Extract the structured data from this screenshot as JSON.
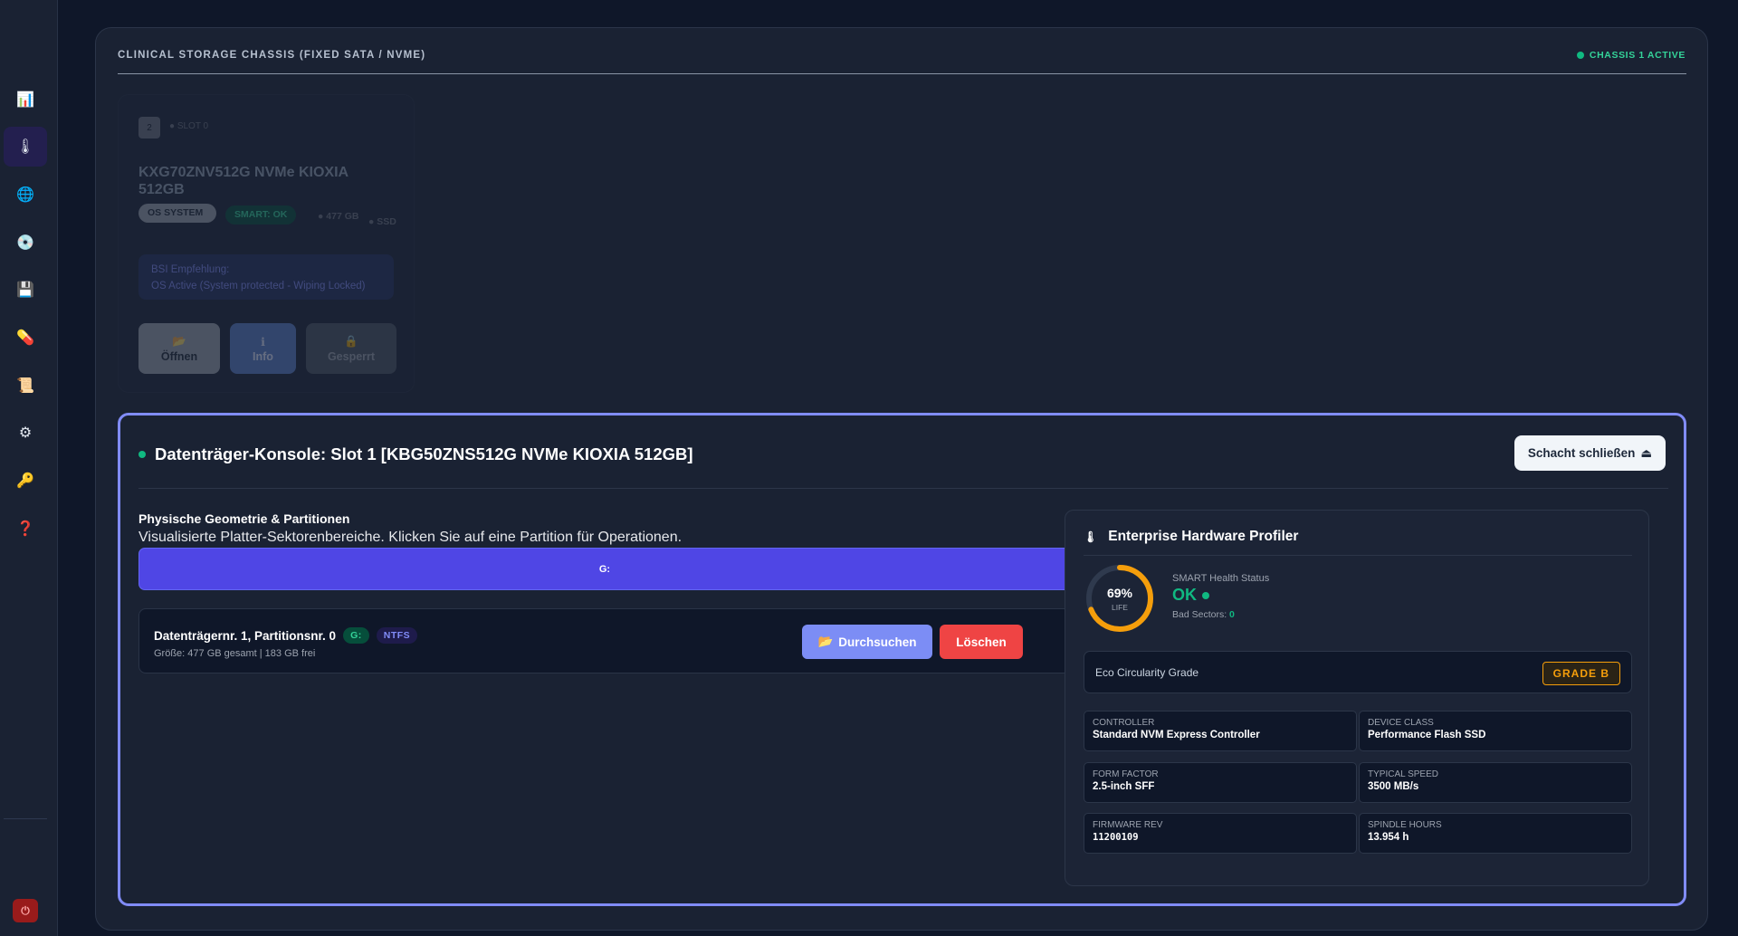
{
  "sidebar": {
    "items": [
      {
        "name": "chart-icon",
        "glyph": "📊"
      },
      {
        "name": "thermometer-icon",
        "glyph": "🌡"
      },
      {
        "name": "globe-icon",
        "glyph": "🌐"
      },
      {
        "name": "disc-icon",
        "glyph": "💿"
      },
      {
        "name": "floppy-icon",
        "glyph": "💾"
      },
      {
        "name": "pill-icon",
        "glyph": "💊"
      },
      {
        "name": "scroll-icon",
        "glyph": "📜"
      },
      {
        "name": "gear-icon",
        "glyph": "⚙"
      },
      {
        "name": "key-icon",
        "glyph": "🔑"
      },
      {
        "name": "help-icon",
        "glyph": "❓"
      }
    ],
    "power_glyph": "⏻"
  },
  "chassis": {
    "title": "CLINICAL STORAGE CHASSIS (FIXED SATA / NVME)",
    "status": "CHASSIS 1 ACTIVE"
  },
  "drive_card": {
    "slot_number": "2",
    "slot_label": "SLOT 0",
    "model": "KXG70ZNV512G NVMe KIOXIA 512GB",
    "os_chip": "OS SYSTEM",
    "smart_chip": "SMART: OK",
    "size": "477 GB",
    "type": "SSD",
    "rec_label": "BSI Empfehlung:",
    "rec_text": "OS Active (System protected - Wiping Locked)",
    "btn_open": "Öffnen",
    "btn_info": "Info",
    "btn_locked": "Gesperrt",
    "btn_open_glyph": "📂",
    "btn_info_glyph": "ℹ",
    "btn_locked_glyph": "🔒"
  },
  "console": {
    "title": "Datenträger-Konsole: Slot 1 [KBG50ZNS512G NVMe KIOXIA 512GB]",
    "close_button": "Schacht schließen",
    "close_glyph": "⏏",
    "geometry_title": "Physische Geometrie & Partitionen",
    "geometry_subtitle": "Visualisierte Platter-Sektorenbereiche. Klicken Sie auf eine Partition für Operationen.",
    "partition_bar_label": "G:",
    "partition": {
      "name": "Datenträgernr. 1, Partitionsnr. 0",
      "drive_letter": "G:",
      "filesystem": "NTFS",
      "meta": "Größe: 477 GB gesamt | 183 GB frei",
      "browse_button": "Durchsuchen",
      "browse_glyph": "📂",
      "delete_button": "Löschen"
    }
  },
  "profiler": {
    "title": "Enterprise Hardware Profiler",
    "title_glyph": "🌡",
    "life_percent": 69,
    "life_text": "69%",
    "life_label": "LIFE",
    "health_label": "SMART Health Status",
    "health_value": "OK",
    "bad_sectors_label": "Bad Sectors:",
    "bad_sectors_value": "0",
    "eco_label": "Eco Circularity Grade",
    "eco_grade": "GRADE B",
    "specs": [
      {
        "key": "CONTROLLER",
        "value": "Standard NVM Express Controller"
      },
      {
        "key": "DEVICE CLASS",
        "value": "Performance Flash SSD"
      },
      {
        "key": "FORM FACTOR",
        "value": "2.5-inch SFF"
      },
      {
        "key": "TYPICAL SPEED",
        "value": "3500 MB/s"
      },
      {
        "key": "FIRMWARE REV",
        "value": "11200109"
      },
      {
        "key": "SPINDLE HOURS",
        "value": "13.954 h"
      }
    ]
  },
  "colors": {
    "accent": "#818cf8",
    "success": "#10b981",
    "danger": "#ef4444",
    "warning": "#f59e0b",
    "partition": "#4f46e5"
  }
}
